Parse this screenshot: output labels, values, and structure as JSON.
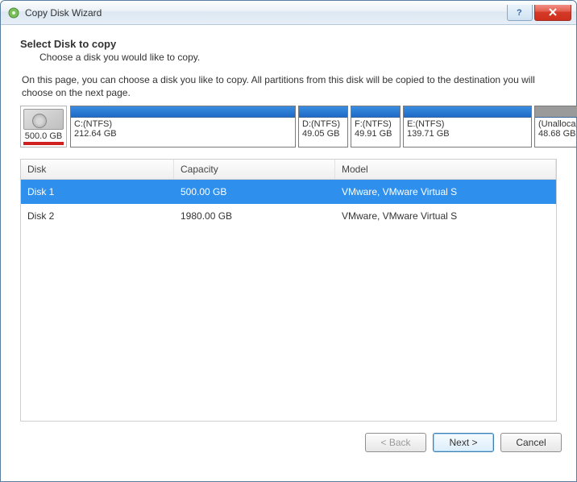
{
  "window": {
    "title": "Copy Disk Wizard"
  },
  "header": {
    "heading": "Select Disk to copy",
    "subtext": "Choose a disk you would like to copy."
  },
  "instruction": "On this page, you can choose a disk you like to copy. All partitions from this disk will be copied to the destination you will choose on the next page.",
  "source_disk": {
    "size_label": "500.0 GB",
    "partitions": [
      {
        "label": "C:(NTFS)",
        "size": "212.64 GB",
        "flex": 280
      },
      {
        "label": "D:(NTFS)",
        "size": "49.05 GB",
        "flex": 62
      },
      {
        "label": "F:(NTFS)",
        "size": "49.91 GB",
        "flex": 62
      },
      {
        "label": "E:(NTFS)",
        "size": "139.71 GB",
        "flex": 160
      },
      {
        "label": "(Unalloca",
        "size": "48.68 GB",
        "flex": 55,
        "unalloc": true
      }
    ]
  },
  "table": {
    "columns": {
      "disk": "Disk",
      "capacity": "Capacity",
      "model": "Model"
    },
    "rows": [
      {
        "disk": "Disk 1",
        "capacity": "500.00 GB",
        "model": "VMware, VMware Virtual S",
        "selected": true
      },
      {
        "disk": "Disk 2",
        "capacity": "1980.00 GB",
        "model": "VMware, VMware Virtual S",
        "selected": false
      }
    ]
  },
  "buttons": {
    "back": "< Back",
    "next": "Next >",
    "cancel": "Cancel"
  }
}
